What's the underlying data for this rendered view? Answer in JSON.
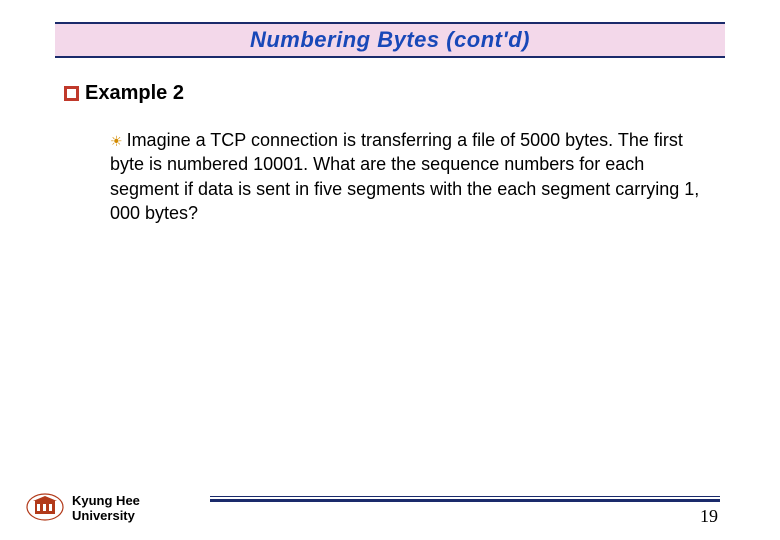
{
  "title": "Numbering Bytes (cont'd)",
  "heading": "Example 2",
  "body": "Imagine a TCP connection is transferring a file of 5000 bytes. The first byte is numbered 10001. What are the sequence numbers for each segment if data is sent in five segments with the each segment carrying 1, 000 bytes?",
  "org_line1": "Kyung Hee",
  "org_line2": "University",
  "page_number": "19"
}
